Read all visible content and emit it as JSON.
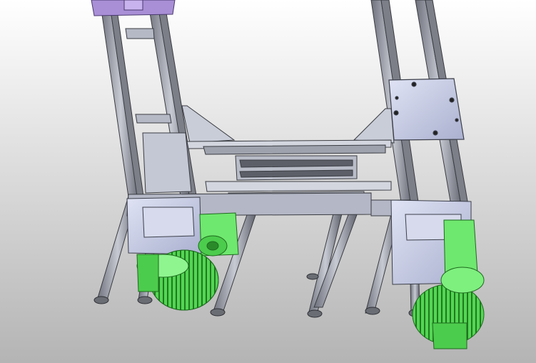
{
  "viewport": {
    "background_top": "#ffffff",
    "background_bottom": "#b4b4b4"
  },
  "model": {
    "colors": {
      "frame_steel": "#8c8f99",
      "frame_dark": "#4a4d55",
      "plate_blue_grey": "#c6cbe4",
      "plate_outline": "#3c3f4a",
      "motor_green": "#5ee35e",
      "motor_green_dark": "#2c9a2c",
      "bracket_violet": "#a98fd6"
    },
    "icons": [
      "motor-icon",
      "gearbox-icon",
      "leveling-foot-icon",
      "mounting-plate-icon"
    ]
  }
}
